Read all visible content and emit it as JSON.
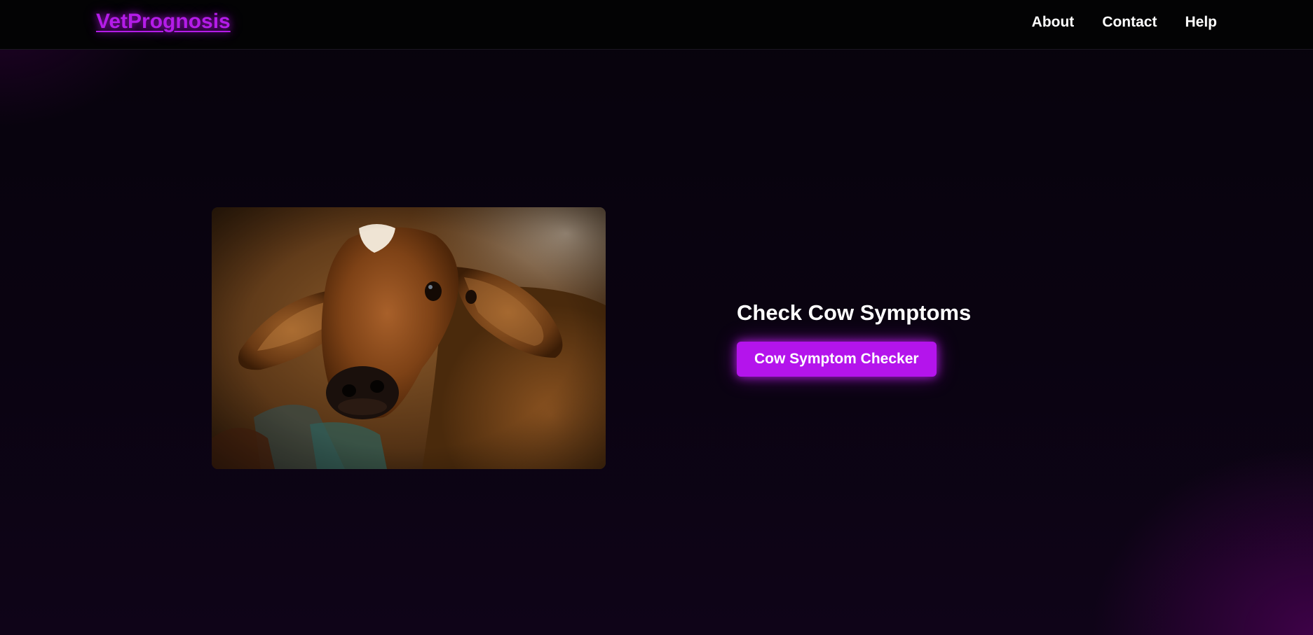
{
  "header": {
    "brand": "VetPrognosis",
    "nav": [
      {
        "label": "About"
      },
      {
        "label": "Contact"
      },
      {
        "label": "Help"
      }
    ]
  },
  "hero": {
    "image_alt": "Brown calf with a white forehead patch looking at the camera",
    "title": "Check Cow Symptoms",
    "button_label": "Cow Symptom Checker"
  },
  "colors": {
    "accent": "#b414ec",
    "background": "#0a0311",
    "navbar": "#030304"
  }
}
